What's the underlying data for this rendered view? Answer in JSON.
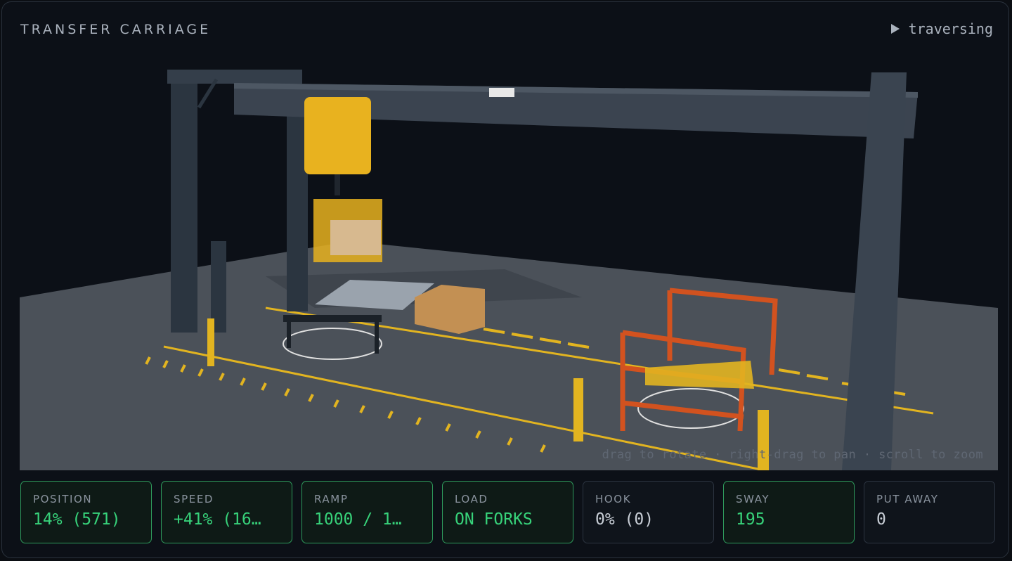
{
  "header": {
    "title": "TRANSFER CARRIAGE",
    "status": "traversing",
    "status_icon": "play-icon"
  },
  "viewport": {
    "hint": "drag to rotate · right-drag to pan · scroll to zoom"
  },
  "metrics": [
    {
      "label": "POSITION",
      "value": "14% (571)",
      "active": true
    },
    {
      "label": "SPEED",
      "value": "+41% (16…",
      "active": true
    },
    {
      "label": "RAMP",
      "value": "1000 / 1…",
      "active": true
    },
    {
      "label": "LOAD",
      "value": "ON FORKS",
      "active": true
    },
    {
      "label": "HOOK",
      "value": "0% (0)",
      "active": false
    },
    {
      "label": "SWAY",
      "value": "195",
      "active": true
    },
    {
      "label": "PUT AWAY",
      "value": "0",
      "active": false
    }
  ],
  "colors": {
    "active_border": "#2e9a5c",
    "active_value": "#37d27a",
    "crane_yellow": "#e8b21f",
    "rack_orange": "#d2521f"
  }
}
